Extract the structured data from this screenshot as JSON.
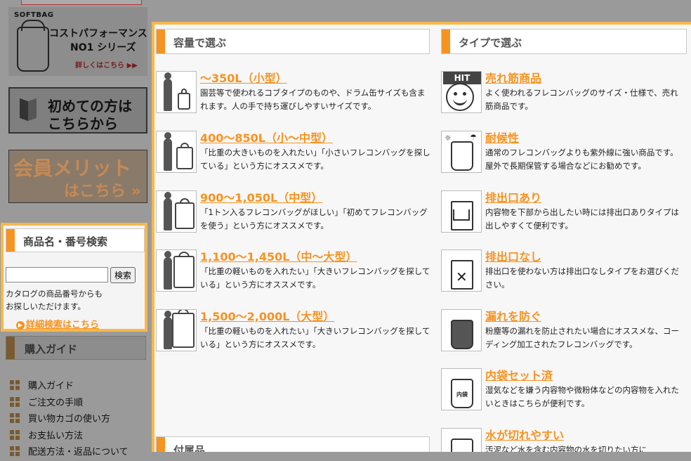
{
  "sidebar": {
    "banner_cost": {
      "brand": "SOFTBAG",
      "line1": "コストパフォーマンス",
      "line2": "NO1 シリーズ",
      "more": "詳しくはこちら ▶▶"
    },
    "banner_beginner": {
      "line1": "初めての方は",
      "line2": "こちらから"
    },
    "banner_member": {
      "line1": "会員メリット",
      "line2": "はこちら »"
    },
    "search": {
      "title": "商品名・番号検索",
      "input_value": "",
      "button": "検索",
      "note": "カタログの商品番号からも\nお探しいただけます。",
      "detail_link": "詳細検索はこちら"
    },
    "guide": {
      "title": "購入ガイド",
      "items": [
        "購入ガイド",
        "ご注文の手順",
        "買い物カゴの使い方",
        "お支払い方法",
        "配送方法・返品について"
      ]
    }
  },
  "main": {
    "capacity": {
      "title": "容量で選ぶ",
      "items": [
        {
          "title": "～350L（小型）",
          "desc": "園芸等で使われるコブタイプのものや、ドラム缶サイズも含まれます。人の手で持ち運びしやすいサイズです。"
        },
        {
          "title": "400～850L（小～中型）",
          "desc": "「比重の大きいものを入れたい」「小さいフレコンバッグを探している」という方にオススメです。"
        },
        {
          "title": "900～1,050L（中型）",
          "desc": "「1トン入るフレコンバッグがほしい」「初めてフレコンバッグを使う」という方にオススメです。"
        },
        {
          "title": "1,100～1,450L（中～大型）",
          "desc": "「比重の軽いものを入れたい」「大きいフレコンバッグを探している」という方にオススメです。"
        },
        {
          "title": "1,500～2,000L（大型）",
          "desc": "「比重の軽いものを入れたい」「大きいフレコンバッグを探している」という方にオススメです。"
        }
      ]
    },
    "type": {
      "title": "タイプで選ぶ",
      "items": [
        {
          "title": "売れ筋商品",
          "desc": "よく使われるフレコンバッグのサイズ・仕様で、売れ筋商品です。",
          "icon_label": "HIT"
        },
        {
          "title": "耐候性",
          "desc": "通常のフレコンバッグよりも紫外線に強い商品です。屋外で長期保管する場合などにお勧めです。"
        },
        {
          "title": "排出口あり",
          "desc": "内容物を下部から出したい時には排出口ありタイプは出しやすくて便利です。"
        },
        {
          "title": "排出口なし",
          "desc": "排出口を使わない方は排出口なしタイプをお選びください。"
        },
        {
          "title": "漏れを防ぐ",
          "desc": "粉塵等の漏れを防止されたい場合にオススメな、コーディング加工されたフレコンバッグです。"
        },
        {
          "title": "内袋セット済",
          "desc": "湿気などを嫌う内容物や微粉体などの内容物を入れたいときはこちらが便利です。",
          "icon_label": "内袋"
        },
        {
          "title": "水が切れやすい",
          "desc": "汚泥など水を含む内容物の水を切りたい方に"
        }
      ]
    },
    "accessories": {
      "title": "付属品"
    }
  }
}
